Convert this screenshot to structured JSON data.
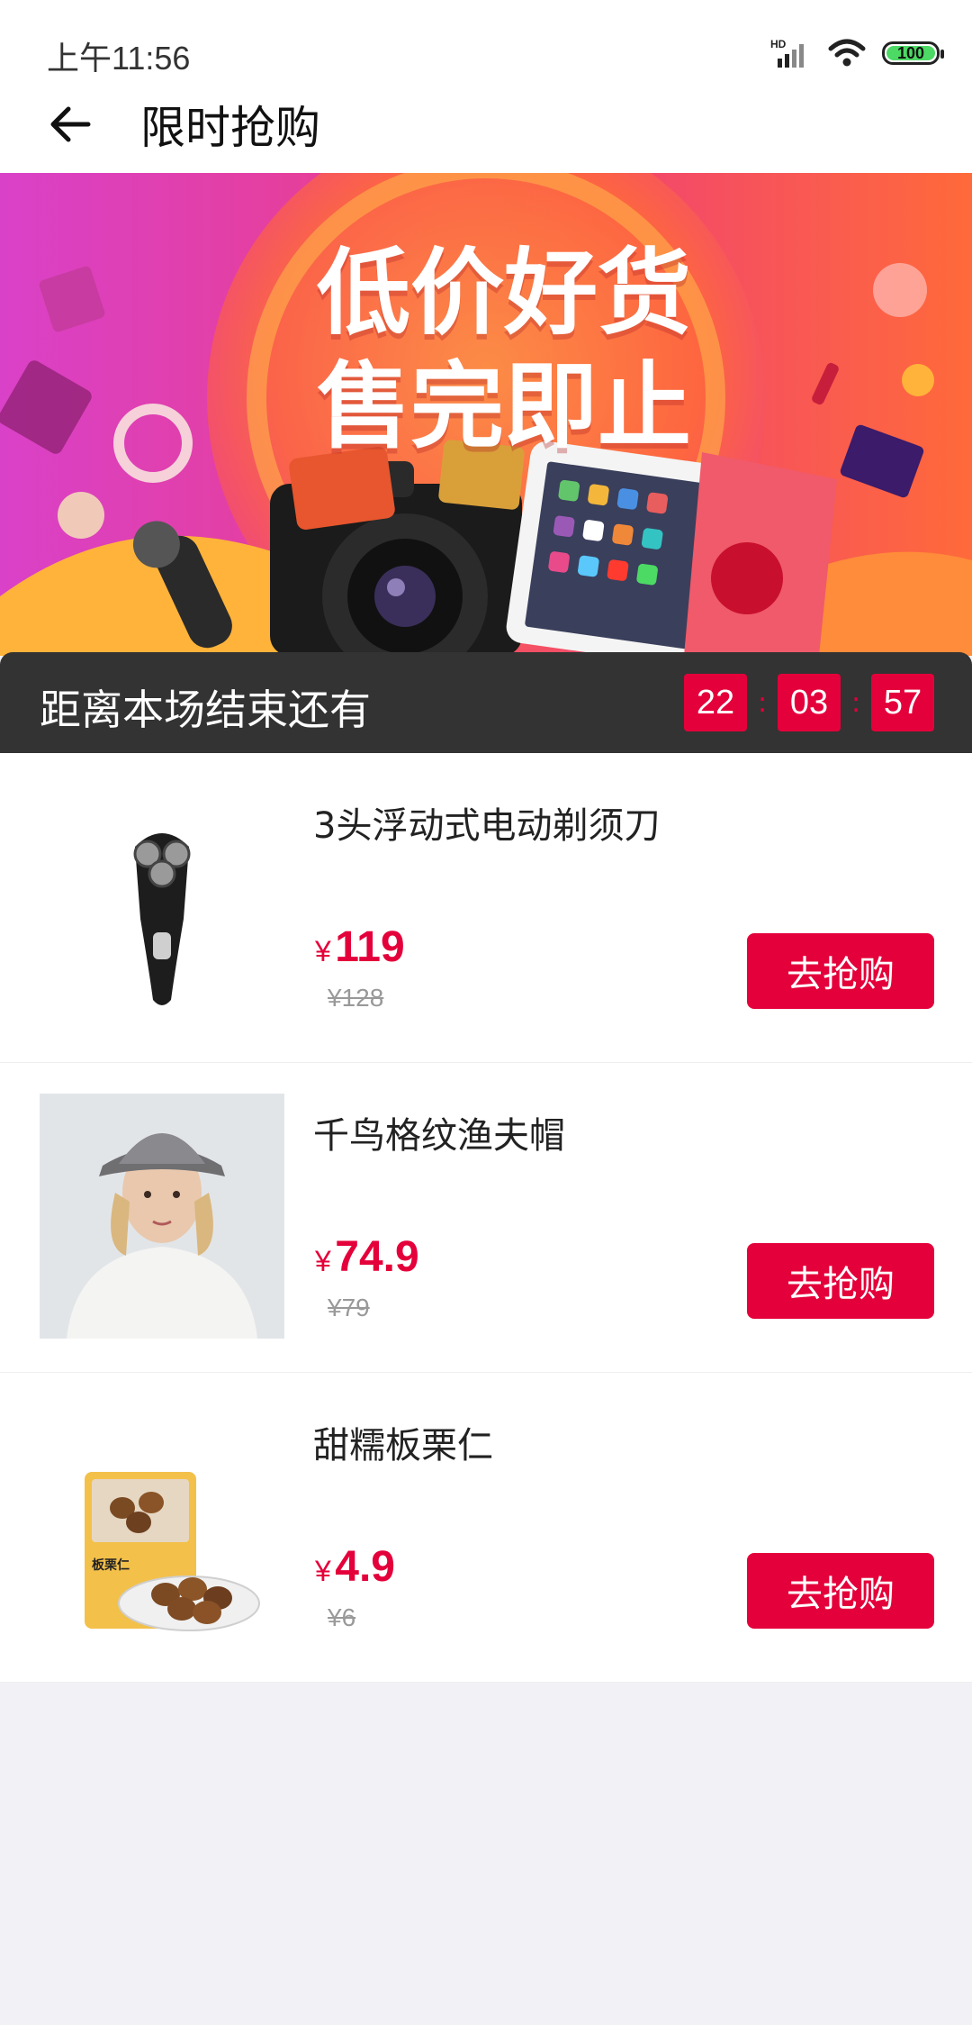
{
  "status": {
    "time": "上午11:56",
    "signal_label": "HD",
    "battery": "100"
  },
  "header": {
    "title": "限时抢购"
  },
  "banner": {
    "slogan_line1": "低价好货",
    "slogan_line2": "售完即止"
  },
  "countdown": {
    "label": "距离本场结束还有",
    "hours": "22",
    "minutes": "03",
    "seconds": "57",
    "separator": ":"
  },
  "products": [
    {
      "name": "3头浮动式电动剃须刀",
      "currency": "¥",
      "price": "119",
      "original_price": "¥128",
      "button": "去抢购"
    },
    {
      "name": "千鸟格纹渔夫帽",
      "currency": "¥",
      "price": "74.9",
      "original_price": "¥79",
      "button": "去抢购"
    },
    {
      "name": "甜糯板栗仁",
      "currency": "¥",
      "price": "4.9",
      "original_price": "¥6",
      "button": "去抢购"
    }
  ],
  "chestnut_pack_label": "板栗仁",
  "colors": {
    "accent": "#e4003a",
    "countdown_bg": "#333333",
    "page_bg": "#f2f2f6"
  }
}
